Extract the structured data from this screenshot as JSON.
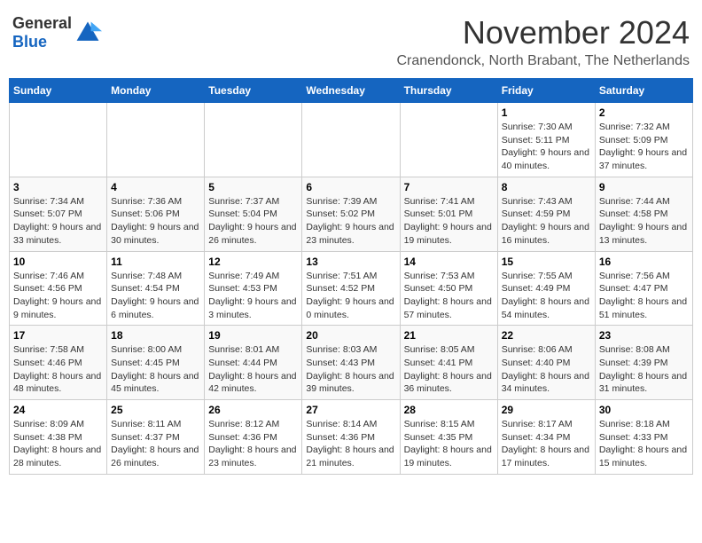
{
  "logo": {
    "general": "General",
    "blue": "Blue"
  },
  "header": {
    "month_title": "November 2024",
    "subtitle": "Cranendonck, North Brabant, The Netherlands"
  },
  "days_of_week": [
    "Sunday",
    "Monday",
    "Tuesday",
    "Wednesday",
    "Thursday",
    "Friday",
    "Saturday"
  ],
  "weeks": [
    [
      {
        "day": "",
        "info": ""
      },
      {
        "day": "",
        "info": ""
      },
      {
        "day": "",
        "info": ""
      },
      {
        "day": "",
        "info": ""
      },
      {
        "day": "",
        "info": ""
      },
      {
        "day": "1",
        "info": "Sunrise: 7:30 AM\nSunset: 5:11 PM\nDaylight: 9 hours and 40 minutes."
      },
      {
        "day": "2",
        "info": "Sunrise: 7:32 AM\nSunset: 5:09 PM\nDaylight: 9 hours and 37 minutes."
      }
    ],
    [
      {
        "day": "3",
        "info": "Sunrise: 7:34 AM\nSunset: 5:07 PM\nDaylight: 9 hours and 33 minutes."
      },
      {
        "day": "4",
        "info": "Sunrise: 7:36 AM\nSunset: 5:06 PM\nDaylight: 9 hours and 30 minutes."
      },
      {
        "day": "5",
        "info": "Sunrise: 7:37 AM\nSunset: 5:04 PM\nDaylight: 9 hours and 26 minutes."
      },
      {
        "day": "6",
        "info": "Sunrise: 7:39 AM\nSunset: 5:02 PM\nDaylight: 9 hours and 23 minutes."
      },
      {
        "day": "7",
        "info": "Sunrise: 7:41 AM\nSunset: 5:01 PM\nDaylight: 9 hours and 19 minutes."
      },
      {
        "day": "8",
        "info": "Sunrise: 7:43 AM\nSunset: 4:59 PM\nDaylight: 9 hours and 16 minutes."
      },
      {
        "day": "9",
        "info": "Sunrise: 7:44 AM\nSunset: 4:58 PM\nDaylight: 9 hours and 13 minutes."
      }
    ],
    [
      {
        "day": "10",
        "info": "Sunrise: 7:46 AM\nSunset: 4:56 PM\nDaylight: 9 hours and 9 minutes."
      },
      {
        "day": "11",
        "info": "Sunrise: 7:48 AM\nSunset: 4:54 PM\nDaylight: 9 hours and 6 minutes."
      },
      {
        "day": "12",
        "info": "Sunrise: 7:49 AM\nSunset: 4:53 PM\nDaylight: 9 hours and 3 minutes."
      },
      {
        "day": "13",
        "info": "Sunrise: 7:51 AM\nSunset: 4:52 PM\nDaylight: 9 hours and 0 minutes."
      },
      {
        "day": "14",
        "info": "Sunrise: 7:53 AM\nSunset: 4:50 PM\nDaylight: 8 hours and 57 minutes."
      },
      {
        "day": "15",
        "info": "Sunrise: 7:55 AM\nSunset: 4:49 PM\nDaylight: 8 hours and 54 minutes."
      },
      {
        "day": "16",
        "info": "Sunrise: 7:56 AM\nSunset: 4:47 PM\nDaylight: 8 hours and 51 minutes."
      }
    ],
    [
      {
        "day": "17",
        "info": "Sunrise: 7:58 AM\nSunset: 4:46 PM\nDaylight: 8 hours and 48 minutes."
      },
      {
        "day": "18",
        "info": "Sunrise: 8:00 AM\nSunset: 4:45 PM\nDaylight: 8 hours and 45 minutes."
      },
      {
        "day": "19",
        "info": "Sunrise: 8:01 AM\nSunset: 4:44 PM\nDaylight: 8 hours and 42 minutes."
      },
      {
        "day": "20",
        "info": "Sunrise: 8:03 AM\nSunset: 4:43 PM\nDaylight: 8 hours and 39 minutes."
      },
      {
        "day": "21",
        "info": "Sunrise: 8:05 AM\nSunset: 4:41 PM\nDaylight: 8 hours and 36 minutes."
      },
      {
        "day": "22",
        "info": "Sunrise: 8:06 AM\nSunset: 4:40 PM\nDaylight: 8 hours and 34 minutes."
      },
      {
        "day": "23",
        "info": "Sunrise: 8:08 AM\nSunset: 4:39 PM\nDaylight: 8 hours and 31 minutes."
      }
    ],
    [
      {
        "day": "24",
        "info": "Sunrise: 8:09 AM\nSunset: 4:38 PM\nDaylight: 8 hours and 28 minutes."
      },
      {
        "day": "25",
        "info": "Sunrise: 8:11 AM\nSunset: 4:37 PM\nDaylight: 8 hours and 26 minutes."
      },
      {
        "day": "26",
        "info": "Sunrise: 8:12 AM\nSunset: 4:36 PM\nDaylight: 8 hours and 23 minutes."
      },
      {
        "day": "27",
        "info": "Sunrise: 8:14 AM\nSunset: 4:36 PM\nDaylight: 8 hours and 21 minutes."
      },
      {
        "day": "28",
        "info": "Sunrise: 8:15 AM\nSunset: 4:35 PM\nDaylight: 8 hours and 19 minutes."
      },
      {
        "day": "29",
        "info": "Sunrise: 8:17 AM\nSunset: 4:34 PM\nDaylight: 8 hours and 17 minutes."
      },
      {
        "day": "30",
        "info": "Sunrise: 8:18 AM\nSunset: 4:33 PM\nDaylight: 8 hours and 15 minutes."
      }
    ]
  ]
}
